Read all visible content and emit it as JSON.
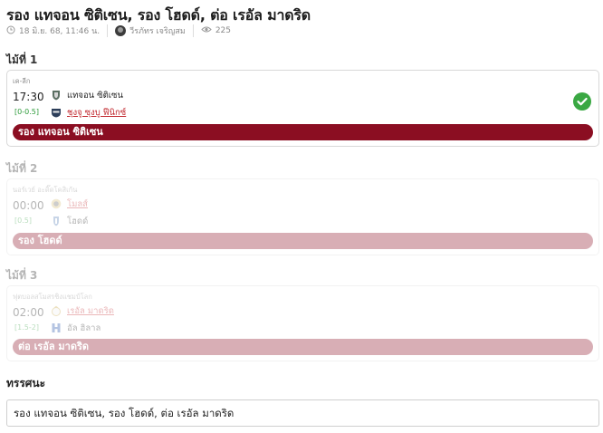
{
  "title": "รอง แทจอน ซิติเซน, รอง โฮดด์, ต่อ เรอัล มาดริด",
  "meta": {
    "date": "18 มิ.ย. 68, 11:46 น.",
    "author": "วีรภัทร เจริญสม",
    "views": "225",
    "clock_icon": "clock-icon",
    "eye_icon": "eye-icon"
  },
  "pairs": [
    {
      "label": "ไม้ที่ 1",
      "league": "เค-ลีก",
      "time": "17:30",
      "handicap": "[0-0.5]",
      "home": "แทจอน ซิติเซน",
      "away": "ชุงจู ซุงบู ฟีนิกซ์",
      "pick": "รอง แทจอน ซิติเซน",
      "result_icon": "check-icon",
      "colors": {
        "pick_bar": "#8b0e22",
        "handicap": "#2e9b3a",
        "link": "#c1272d"
      }
    },
    {
      "label": "ไม้ที่ 2",
      "league": "นอร์เวย์ อะดิ๊ดโคสิเก้น",
      "time": "00:00",
      "handicap": "[0.5]",
      "home": "โมลส์",
      "away": "โฮดด์",
      "pick": "รอง โฮดด์"
    },
    {
      "label": "ไม้ที่ 3",
      "league": "ฟุตบอลสโมสรชิงแชมป์โลก",
      "time": "02:00",
      "handicap": "[1.5-2]",
      "home": "เรอัล มาดริด",
      "away": "อัล ฮิลาล",
      "pick": "ต่อ เรอัล มาดริด"
    }
  ],
  "opinion": {
    "label": "ทรรศนะ",
    "text": "รอง แทจอน ซิติเซน, รอง โฮดด์, ต่อ เรอัล มาดริด"
  }
}
